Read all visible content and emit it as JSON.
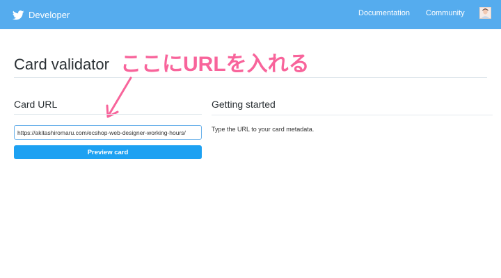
{
  "header": {
    "brand": "Developer",
    "nav": [
      {
        "label": "Documentation"
      },
      {
        "label": "Community"
      }
    ],
    "brand_color": "#55acee"
  },
  "page": {
    "title": "Card validator"
  },
  "card_url": {
    "heading": "Card URL",
    "value": "https://akitashiromaru.com/ecshop-web-designer-working-hours/",
    "button_label": "Preview card"
  },
  "getting_started": {
    "heading": "Getting started",
    "text": "Type the URL to your card metadata."
  },
  "annotation": {
    "text": "ここにURLを入れる",
    "color": "#f8649b"
  },
  "icons": [
    "twitter-bird-icon",
    "avatar",
    "arrow-icon"
  ]
}
